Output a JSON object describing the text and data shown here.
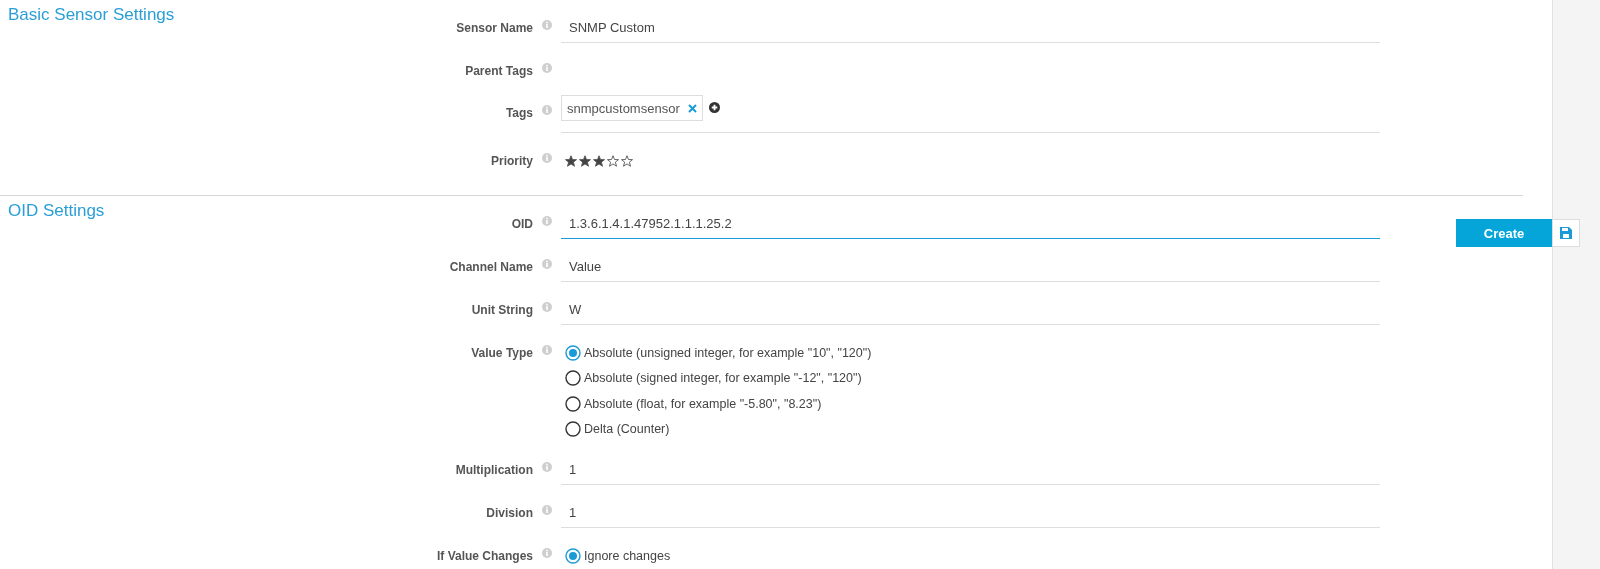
{
  "sections": [
    {
      "title": "Basic Sensor Settings",
      "rows": [
        {
          "kind": "text",
          "label": "Sensor Name",
          "value": "SNMP Custom",
          "focused": false
        },
        {
          "kind": "empty",
          "label": "Parent Tags"
        },
        {
          "kind": "tags",
          "label": "Tags",
          "tags": [
            "snmpcustomsensor"
          ]
        },
        {
          "kind": "stars",
          "label": "Priority",
          "stars": 3
        }
      ]
    },
    {
      "title": "OID Settings",
      "rows": [
        {
          "kind": "text",
          "label": "OID",
          "value": "1.3.6.1.4.1.47952.1.1.1.25.2",
          "focused": true
        },
        {
          "kind": "text",
          "label": "Channel Name",
          "value": "Value",
          "focused": false
        },
        {
          "kind": "text",
          "label": "Unit String",
          "value": "W",
          "focused": false
        },
        {
          "kind": "radio",
          "label": "Value Type",
          "options": [
            {
              "label": "Absolute (unsigned integer, for example \"10\", \"120\")",
              "selected": true
            },
            {
              "label": "Absolute (signed integer, for example \"-12\", \"120\")",
              "selected": false
            },
            {
              "label": "Absolute (float, for example \"-5.80\", \"8.23\")",
              "selected": false
            },
            {
              "label": "Delta (Counter)",
              "selected": false
            }
          ]
        },
        {
          "kind": "text",
          "label": "Multiplication",
          "value": "1",
          "focused": false
        },
        {
          "kind": "text",
          "label": "Division",
          "value": "1",
          "focused": false
        },
        {
          "kind": "radio",
          "label": "If Value Changes",
          "options": [
            {
              "label": "Ignore changes",
              "selected": true
            }
          ]
        }
      ]
    }
  ],
  "actions": {
    "create": "Create"
  }
}
